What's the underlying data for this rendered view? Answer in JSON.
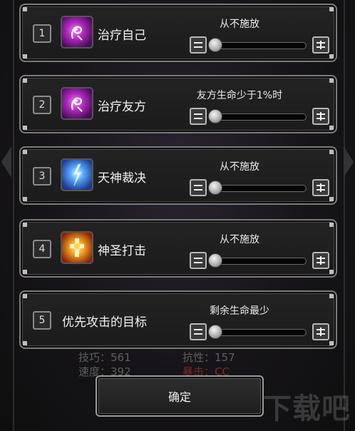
{
  "background": {
    "stats": [
      {
        "label": "技巧：561",
        "color": "#5e5e5e"
      },
      {
        "label": "速度：392",
        "color": "#5e5e5e"
      },
      {
        "label": "抗性：157",
        "color": "#5e5e5e"
      },
      {
        "label": "暴击：CC",
        "color": "#7a2a2a"
      }
    ],
    "watermark": "下载吧",
    "watermark_url": "www.xiazaiba.com"
  },
  "rules": [
    {
      "number": "1",
      "skill": "治疗自己",
      "icon": "heal-icon",
      "condition": "从不施放",
      "level": 0
    },
    {
      "number": "2",
      "skill": "治疗友方",
      "icon": "heal-icon",
      "condition": "友方生命少于1%时",
      "level": 0
    },
    {
      "number": "3",
      "skill": "天神裁决",
      "icon": "lightning-icon",
      "condition": "从不施放",
      "level": 0
    },
    {
      "number": "4",
      "skill": "神圣打击",
      "icon": "holy-strike-icon",
      "condition": "从不施放",
      "level": 0
    },
    {
      "number": "5",
      "skill": "优先攻击的目标",
      "icon": "",
      "condition": "剩余生命最少",
      "level": 0
    }
  ],
  "controls": {
    "minus_label": "−",
    "plus_label": "+"
  },
  "confirm_label": "确定"
}
